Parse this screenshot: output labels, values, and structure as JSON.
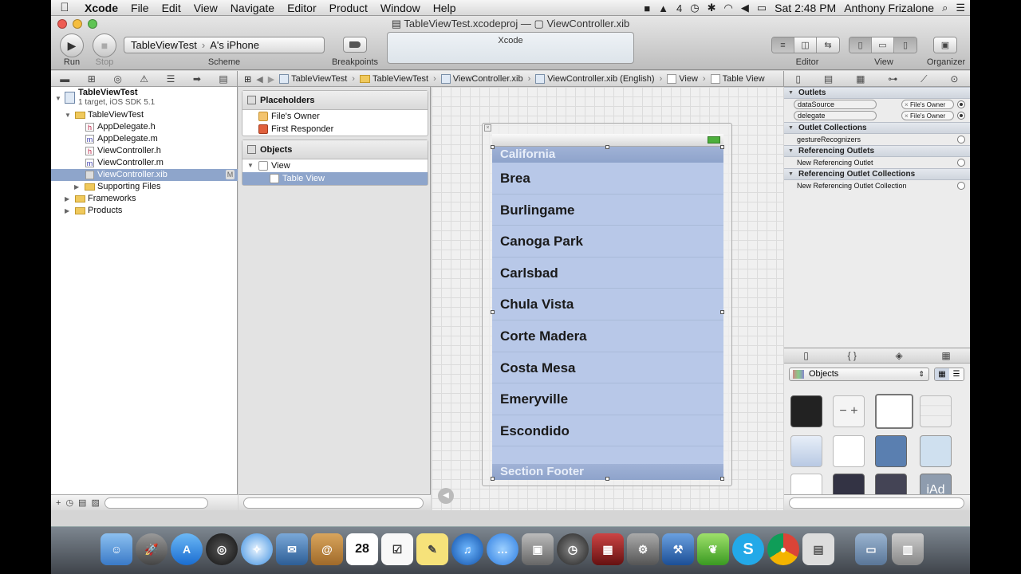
{
  "menubar": {
    "app_name": "Xcode",
    "items": [
      "File",
      "Edit",
      "View",
      "Navigate",
      "Editor",
      "Product",
      "Window",
      "Help"
    ],
    "status_number": "4",
    "clock": "Sat 2:48 PM",
    "user": "Anthony Frizalone"
  },
  "window": {
    "project_file": "TableViewTest.xcodeproj",
    "title_separator": "—",
    "xib_file": "ViewController.xib"
  },
  "toolbar": {
    "run_label": "Run",
    "stop_label": "Stop",
    "scheme_target": "TableViewTest",
    "scheme_device": "A's iPhone",
    "scheme_label": "Scheme",
    "breakpoints_label": "Breakpoints",
    "activity_title": "Xcode",
    "editor_label": "Editor",
    "view_label": "View",
    "organizer_label": "Organizer"
  },
  "jumpbar": {
    "crumbs": [
      "TableViewTest",
      "TableViewTest",
      "ViewController.xib",
      "ViewController.xib (English)",
      "View",
      "Table View"
    ]
  },
  "navigator": {
    "project_name": "TableViewTest",
    "project_sub": "1 target, iOS SDK 5.1",
    "group_name": "TableViewTest",
    "files": [
      "AppDelegate.h",
      "AppDelegate.m",
      "ViewController.h",
      "ViewController.m",
      "ViewController.xib"
    ],
    "file_types": [
      "h",
      "m",
      "h",
      "m",
      "xib"
    ],
    "selected_badge": "M",
    "supporting_files": "Supporting Files",
    "frameworks": "Frameworks",
    "products": "Products"
  },
  "outline": {
    "placeholders_title": "Placeholders",
    "files_owner": "File's Owner",
    "first_responder": "First Responder",
    "objects_title": "Objects",
    "view": "View",
    "table_view": "Table View"
  },
  "canvas": {
    "section_header": "California",
    "cells": [
      "Brea",
      "Burlingame",
      "Canoga Park",
      "Carlsbad",
      "Chula Vista",
      "Corte Madera",
      "Costa Mesa",
      "Emeryville",
      "Escondido"
    ],
    "section_footer": "Section Footer"
  },
  "inspector": {
    "outlets_title": "Outlets",
    "outlet_datasource": "dataSource",
    "outlet_delegate": "delegate",
    "connection_target": "File's Owner",
    "outlet_collections_title": "Outlet Collections",
    "gesture_recognizers": "gestureRecognizers",
    "referencing_outlets_title": "Referencing Outlets",
    "new_referencing_outlet": "New Referencing Outlet",
    "referencing_collections_title": "Referencing Outlet Collections",
    "new_referencing_collection": "New Referencing Outlet Collection"
  },
  "library": {
    "selected_library": "Objects",
    "ad_label": "iAd",
    "stepper_label": "− +"
  },
  "dock": {
    "calendar_day": "28"
  },
  "colors": {
    "selection": "#8ea5cb",
    "table_background": "#b8c8e8",
    "section_header_text": "#e8eef9"
  }
}
